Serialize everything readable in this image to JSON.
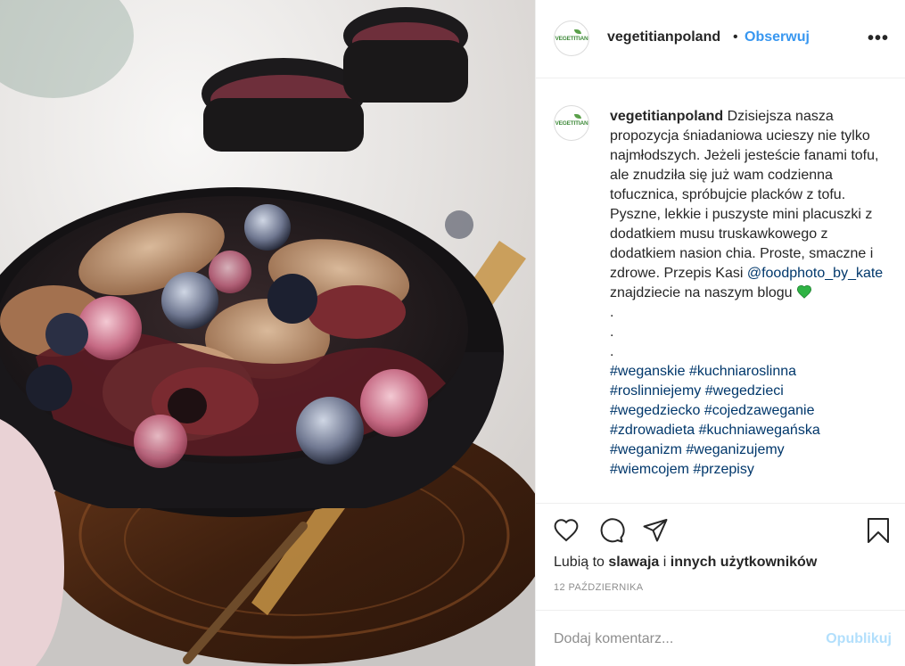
{
  "post": {
    "image_alt": "Pancakes with strawberry mousse and berries in a black bowl",
    "author": {
      "username": "vegetitianpoland",
      "avatar_text": "VEGETITIAN",
      "separator": "•",
      "follow_label": "Obserwuj",
      "more_label": "•••"
    },
    "caption": {
      "username": "vegetitianpoland",
      "text_1": "Dzisiejsza nasza propozycja śniadaniowa ucieszy nie tylko najmłodszych. Jeżeli jesteście fanami tofu, ale znudziła się już wam codzienna tofucznica, spróbujcie placków z tofu. Pyszne, lekkie i puszyste mini placuszki z dodatkiem musu truskawkowego z dodatkiem nasion chia. Proste, smaczne i zdrowe. Przepis Kasi ",
      "mention": "@foodphoto_by_kate",
      "text_2": " znajdziecie na naszym blogu",
      "emoji": "green-heart-icon",
      "dots": [
        ".",
        ".",
        "."
      ],
      "hashtags": [
        "#weganskie",
        "#kuchniaroslinna",
        "#roslinniejemy",
        "#wegedzieci",
        "#wegedziecko",
        "#cojedzaweganie",
        "#zdrowadieta",
        "#kuchniawegańska",
        "#weganizm",
        "#weganizujemy",
        "#wiemcojem",
        "#przepisy"
      ]
    },
    "actions": {
      "like_icon": "heart-icon",
      "comment_icon": "comment-icon",
      "share_icon": "share-icon",
      "save_icon": "bookmark-icon"
    },
    "likes": {
      "prefix": "Lubią to",
      "user": "slawaja",
      "middle": "i",
      "others": "innych użytkowników"
    },
    "date": "12 PAŹDZIERNIKA",
    "add_comment": {
      "placeholder": "Dodaj komentarz...",
      "publish_label": "Opublikuj"
    }
  },
  "colors": {
    "link_blue": "#3897f0",
    "publish_disabled": "#b2dffc",
    "hashtag": "#00376b",
    "heart_green": "#2fb344"
  }
}
